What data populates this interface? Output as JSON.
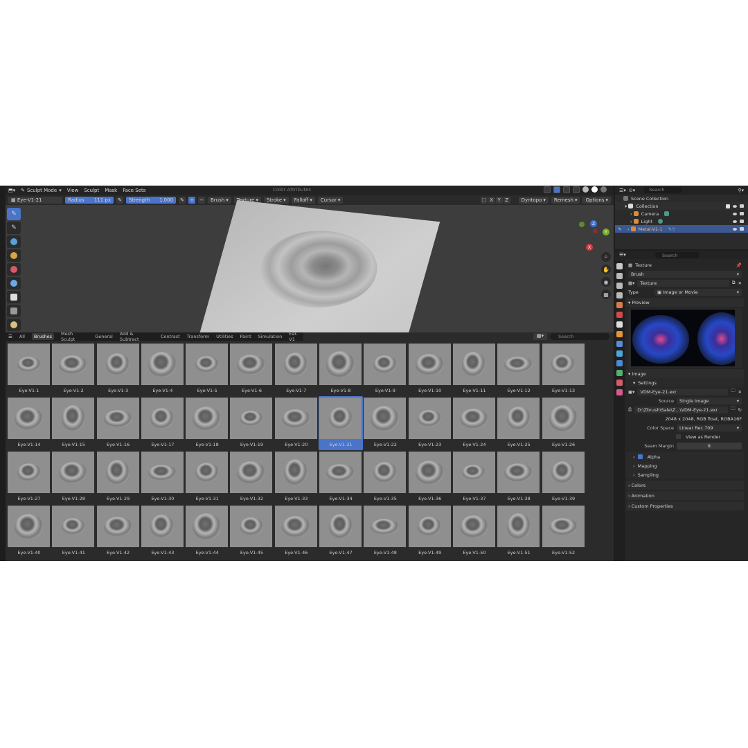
{
  "header": {
    "mode": "Sculpt Mode",
    "menus": [
      "View",
      "Sculpt",
      "Mask",
      "Face Sets"
    ],
    "color_attributes": "Color Attributes"
  },
  "toolbar": {
    "brush_name": "Eye-V1-21",
    "radius_label": "Radius",
    "radius_value": "111 px",
    "strength_label": "Strength",
    "strength_value": "1.000",
    "plus": "+",
    "minus": "−",
    "dropdowns": [
      "Brush",
      "Texture",
      "Stroke",
      "Falloff",
      "Cursor"
    ],
    "axes": [
      "X",
      "Y",
      "Z"
    ],
    "right": [
      "Dyntopo",
      "Remesh",
      "Options"
    ]
  },
  "gizmo": {
    "x": "X",
    "y": "Y",
    "z": "Z"
  },
  "asset_browser": {
    "tabs": [
      "All",
      "Brushes",
      "Mesh Sculpt",
      "General",
      "Add & Subtract",
      "Contrast",
      "Transform",
      "Utilities",
      "Paint",
      "Simulation",
      "Ear-V1"
    ],
    "search_placeholder": "Search",
    "items": [
      "Eye-V1-1",
      "Eye-V1-2",
      "Eye-V1-3",
      "Eye-V1-4",
      "Eye-V1-5",
      "Eye-V1-6",
      "Eye-V1-7",
      "Eye-V1-8",
      "Eye-V1-9",
      "Eye-V1-10",
      "Eye-V1-11",
      "Eye-V1-12",
      "Eye-V1-13",
      "Eye-V1-14",
      "Eye-V1-15",
      "Eye-V1-16",
      "Eye-V1-17",
      "Eye-V1-18",
      "Eye-V1-19",
      "Eye-V1-20",
      "Eye-V1-21",
      "Eye-V1-22",
      "Eye-V1-23",
      "Eye-V1-24",
      "Eye-V1-25",
      "Eye-V1-26",
      "Eye-V1-27",
      "Eye-V1-28",
      "Eye-V1-29",
      "Eye-V1-30",
      "Eye-V1-31",
      "Eye-V1-32",
      "Eye-V1-33",
      "Eye-V1-34",
      "Eye-V1-35",
      "Eye-V1-36",
      "Eye-V1-37",
      "Eye-V1-38",
      "Eye-V1-39",
      "Eye-V1-40",
      "Eye-V1-41",
      "Eye-V1-42",
      "Eye-V1-43",
      "Eye-V1-44",
      "Eye-V1-45",
      "Eye-V1-46",
      "Eye-V1-47",
      "Eye-V1-48",
      "Eye-V1-49",
      "Eye-V1-50",
      "Eye-V1-51",
      "Eye-V1-52"
    ],
    "selected": "Eye-V1-21"
  },
  "outliner": {
    "search_placeholder": "Search",
    "root": "Scene Collection",
    "collection": "Collection",
    "rows": [
      "Camera",
      "Light",
      "Metal-V1-1"
    ]
  },
  "properties": {
    "search_placeholder": "Search",
    "texture_header": "Texture",
    "brush": "Brush",
    "texture_name": "Texture",
    "type_label": "Type",
    "type_value": "Image or Movie",
    "preview": "Preview",
    "image": "Image",
    "settings": "Settings",
    "image_file": "VDM-Eye-21.exr",
    "source_label": "Source",
    "source_value": "Single Image",
    "path": "D:\\Zbrush\\Sale\\Z...\\VDM-Eye-21.exr",
    "info": "2048 x 2048,  RGB float, RGBA16F",
    "colorspace_label": "Color Space",
    "colorspace_value": "Linear Rec.709",
    "view_as_render": "View as Render",
    "seam_label": "Seam Margin",
    "seam_value": "8",
    "subsections": [
      "Alpha",
      "Mapping",
      "Sampling"
    ],
    "panels": [
      "Colors",
      "Animation",
      "Custom Properties"
    ]
  },
  "colors": {
    "accent": "#4a74c9",
    "bg": "#1d1d1d",
    "panel": "#2b2b2b"
  }
}
